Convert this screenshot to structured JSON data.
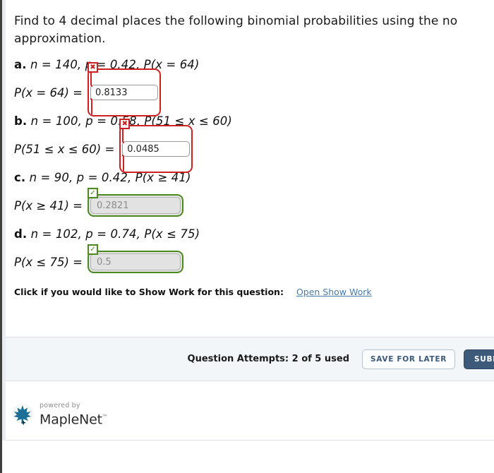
{
  "question": {
    "prompt_line1": "Find to 4 decimal places the following binomial probabilities using the no",
    "prompt_line2": "approximation.",
    "parts": [
      {
        "letter": "a.",
        "given": "n = 140, p = 0.42, P(x = 64)",
        "answer_label": "P(x = 64)  =",
        "value": "0.8133",
        "status": "incorrect",
        "badge_glyph": "✖"
      },
      {
        "letter": "b.",
        "given": "n = 100, p = 0.58, P(51 ≤ x ≤ 60)",
        "answer_label": "P(51 ≤ x ≤ 60)  =",
        "value": "0.0485",
        "status": "incorrect",
        "badge_glyph": "✖"
      },
      {
        "letter": "c.",
        "given": "n = 90, p = 0.42, P(x ≥ 41)",
        "answer_label": "P(x ≥ 41)  =",
        "value": "0.2821",
        "status": "correct",
        "badge_glyph": "✓"
      },
      {
        "letter": "d.",
        "given": "n = 102, p = 0.74, P(x ≤ 75)",
        "answer_label": "P(x ≤ 75)  =",
        "value": "0.5",
        "status": "correct",
        "badge_glyph": "✓"
      }
    ],
    "show_work_label": "Click if you would like to Show Work for this question:",
    "show_work_link": "Open Show Work"
  },
  "actions": {
    "attempts_text": "Question Attempts: 2 of 5 used",
    "save_label": "SAVE FOR LATER",
    "submit_label": "SUBMIT A"
  },
  "branding": {
    "powered_by": "powered by",
    "product": "MapleNet",
    "trademark": "™"
  },
  "colors": {
    "incorrect": "#cf2020",
    "correct": "#4c8a1f",
    "link": "#4a7ba7",
    "primary_button": "#3d5a7a",
    "footer_bg": "#f3f6f9"
  }
}
